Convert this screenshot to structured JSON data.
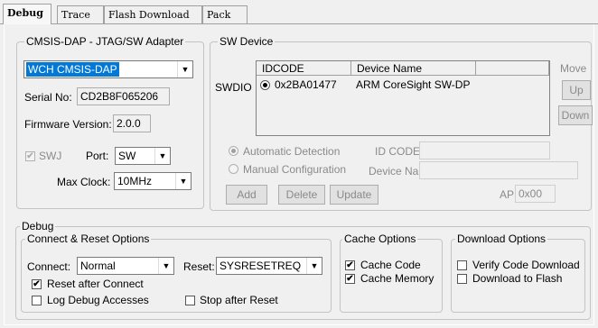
{
  "tabs": [
    "Debug",
    "Trace",
    "Flash Download",
    "Pack"
  ],
  "adapter": {
    "legend": "CMSIS-DAP - JTAG/SW Adapter",
    "device_select": "WCH CMSIS-DAP",
    "serial_label": "Serial No:",
    "serial_value": "CD2B8F065206",
    "firmware_label": "Firmware Version:",
    "firmware_value": "2.0.0",
    "swj_label": "SWJ",
    "port_label": "Port:",
    "port_value": "SW",
    "max_clock_label": "Max Clock:",
    "max_clock_value": "10MHz"
  },
  "sw_device": {
    "legend": "SW Device",
    "swdio_label": "SWDIO",
    "columns": [
      "IDCODE",
      "Device Name"
    ],
    "rows": [
      {
        "idcode": "0x2BA01477",
        "device_name": "ARM CoreSight SW-DP"
      }
    ],
    "move_label": "Move",
    "up_label": "Up",
    "down_label": "Down",
    "auto_detect_label": "Automatic Detection",
    "manual_config_label": "Manual Configuration",
    "id_code_label": "ID CODE:",
    "device_name_label": "Device Name:",
    "add_label": "Add",
    "delete_label": "Delete",
    "update_label": "Update",
    "ap_label": "AP:",
    "ap_value": "0x00"
  },
  "debug": {
    "legend": "Debug",
    "connect_reset": {
      "legend": "Connect & Reset Options",
      "connect_label": "Connect:",
      "connect_value": "Normal",
      "reset_label": "Reset:",
      "reset_value": "SYSRESETREQ",
      "reset_after_connect": "Reset after Connect",
      "log_debug_accesses": "Log Debug Accesses",
      "stop_after_reset": "Stop after Reset"
    },
    "cache": {
      "legend": "Cache Options",
      "cache_code": "Cache Code",
      "cache_memory": "Cache Memory"
    },
    "download": {
      "legend": "Download Options",
      "verify": "Verify Code Download",
      "to_flash": "Download to Flash"
    }
  },
  "icons": {
    "check": "✔",
    "dropdown": "▼"
  }
}
